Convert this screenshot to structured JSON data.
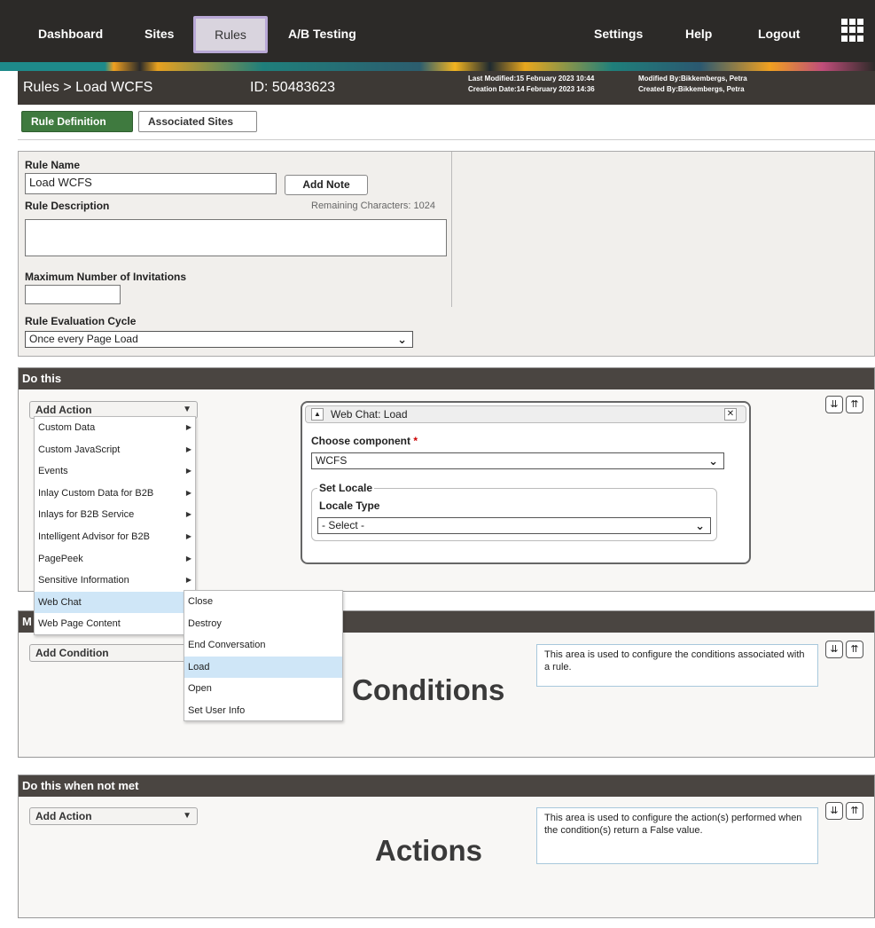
{
  "nav": {
    "items": [
      "Dashboard",
      "Sites",
      "Rules",
      "A/B Testing",
      "Settings",
      "Help",
      "Logout"
    ],
    "active": "Rules"
  },
  "title": {
    "breadcrumb": "Rules > Load WCFS",
    "id_text": "ID: 50483623",
    "last_modified": "Last Modified:15 February 2023 10:44",
    "creation_date": "Creation Date:14 February 2023 14:36",
    "modified_by": "Modified By:Bikkembergs, Petra",
    "created_by": "Created By:Bikkembergs, Petra"
  },
  "tabs": [
    "Rule Definition",
    "Associated Sites"
  ],
  "form": {
    "rule_name_label": "Rule Name",
    "rule_name_value": "Load WCFS",
    "add_note": "Add Note",
    "rule_description_label": "Rule Description",
    "remaining": "Remaining Characters: 1024",
    "max_invitations_label": "Maximum Number of Invitations",
    "eval_cycle_label": "Rule Evaluation Cycle",
    "eval_cycle_value": "Once every Page Load"
  },
  "do_this": {
    "heading": "Do this",
    "add_action": "Add Action",
    "menu": [
      "Custom Data",
      "Custom JavaScript",
      "Events",
      "Inlay Custom Data for B2B",
      "Inlays for B2B Service",
      "Intelligent Advisor for B2B",
      "PagePeek",
      "Sensitive Information",
      "Web Chat",
      "Web Page Content"
    ],
    "submenu": [
      "Close",
      "Destroy",
      "End Conversation",
      "Load",
      "Open",
      "Set User Info"
    ]
  },
  "widget": {
    "title": "Web Chat: Load",
    "choose_component": "Choose component",
    "required_mark": "*",
    "component_value": "WCFS",
    "set_locale": "Set Locale",
    "locale_type": "Locale Type",
    "locale_value": "- Select -"
  },
  "conditions": {
    "heading_initial": "M",
    "add_condition": "Add Condition",
    "info": "This area is used to configure the conditions associated with a rule.",
    "big": "Conditions"
  },
  "not_met": {
    "heading": "Do this when not met",
    "add_action": "Add Action",
    "info": "This area is used to configure the action(s) performed when the condition(s) return a False value.",
    "big": "Actions"
  },
  "icons": {
    "expand": "double-chevron-down-icon",
    "collapse": "double-chevron-up-icon",
    "apps": "grid-menu-icon",
    "dropdown": "chevron-down-icon",
    "submenu_arrow": "triangle-right-icon"
  },
  "colors": {
    "nav_bg": "#2c2a28",
    "active_tab": "#3f7a3f",
    "panel_head": "#4a4541",
    "highlight": "#cfe6f7"
  }
}
